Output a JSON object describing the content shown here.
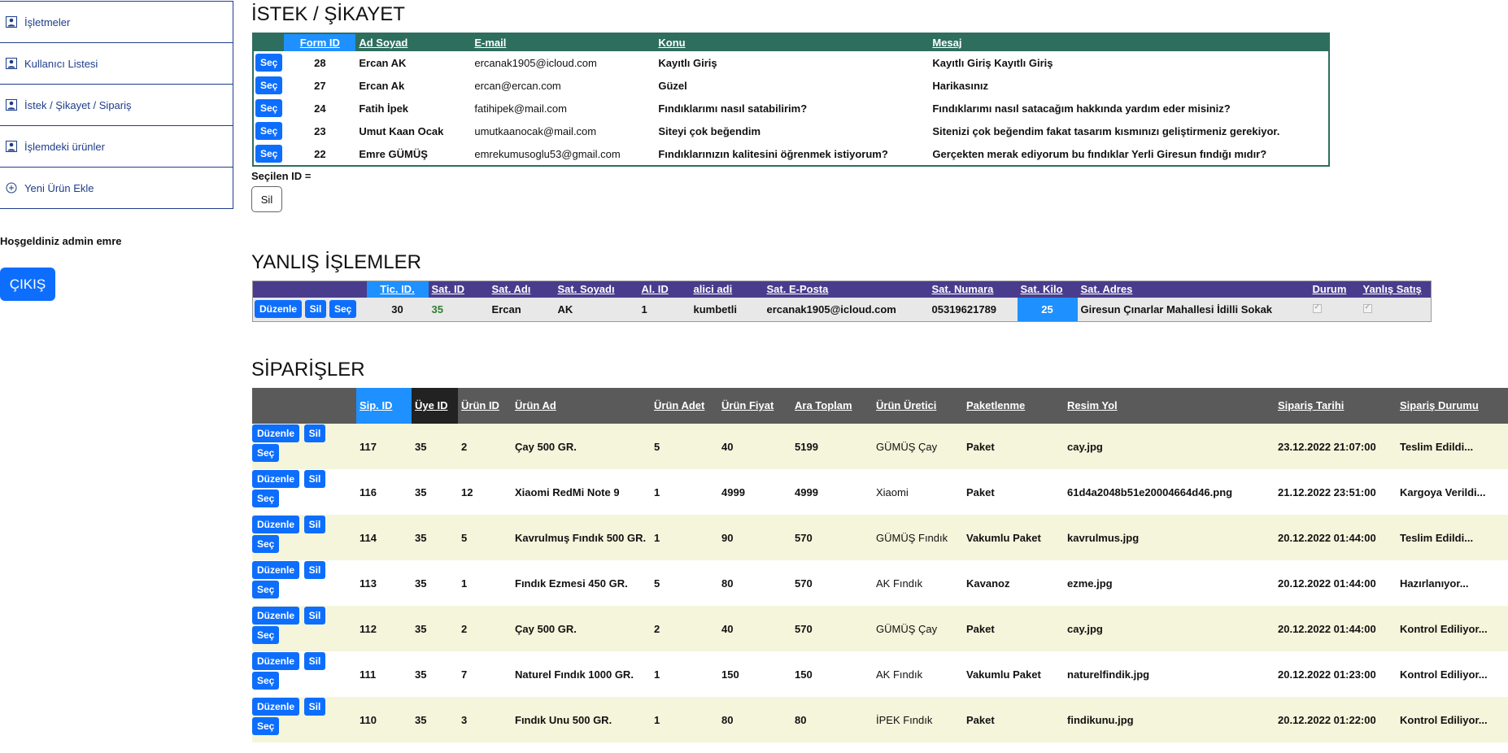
{
  "sidebar": {
    "items": [
      {
        "label": "İşletmeler",
        "icon": "user-icon"
      },
      {
        "label": "Kullanıcı Listesi",
        "icon": "user-icon"
      },
      {
        "label": "İstek / Şikayet / Sipariş",
        "icon": "user-icon"
      },
      {
        "label": "İşlemdeki ürünler",
        "icon": "user-icon"
      },
      {
        "label": "Yeni Ürün Ekle",
        "icon": "plus-circle-icon"
      }
    ],
    "welcome": "Hoşgeldiniz admin emre",
    "exit_label": "ÇIKIŞ"
  },
  "requests": {
    "title": "İSTEK / ŞİKAYET",
    "headers": [
      "Form ID",
      "Ad Soyad",
      "E-mail",
      "Konu",
      "Mesaj"
    ],
    "select_label": "Seç",
    "rows": [
      {
        "id": "28",
        "name": "Ercan AK",
        "email": "ercanak1905@icloud.com",
        "subject": "Kayıtlı Giriş",
        "message": "Kayıtlı Giriş Kayıtlı Giriş"
      },
      {
        "id": "27",
        "name": "Ercan Ak",
        "email": "ercan@ercan.com",
        "subject": "Güzel",
        "message": "Harikasınız"
      },
      {
        "id": "24",
        "name": "Fatih İpek",
        "email": "fatihipek@mail.com",
        "subject": "Fındıklarımı nasıl satabilirim?",
        "message": "Fındıklarımı nasıl satacağım hakkında yardım eder misiniz?"
      },
      {
        "id": "23",
        "name": "Umut Kaan Ocak",
        "email": "umutkaanocak@mail.com",
        "subject": "Siteyi çok beğendim",
        "message": "Sitenizi çok beğendim fakat tasarım kısmınızı geliştirmeniz gerekiyor."
      },
      {
        "id": "22",
        "name": "Emre GÜMÜŞ",
        "email": "emrekumusoglu53@gmail.com",
        "subject": "Fındıklarınızın kalitesini öğrenmek istiyorum?",
        "message": "Gerçekten merak ediyorum bu fındıklar Yerli Giresun fındığı mıdır?"
      }
    ],
    "selected_id_label": "Seçilen ID =",
    "delete_label": "Sil"
  },
  "wrong_ops": {
    "title": "YANLIŞ İŞLEMLER",
    "headers": [
      "Tic. ID.",
      "Sat. ID",
      "Sat. Adı",
      "Sat. Soyadı",
      "Al. ID",
      "alici adi",
      "Sat. E-Posta",
      "Sat. Numara",
      "Sat. Kilo",
      "Sat. Adres",
      "Durum",
      "Yanlış Satış"
    ],
    "actions": [
      "Düzenle",
      "Sil",
      "Seç"
    ],
    "row": {
      "tic_id": "30",
      "sat_id": "35",
      "sat_adi": "Ercan",
      "sat_soyadi": "AK",
      "al_id": "1",
      "alici_adi": "kumbetli",
      "email": "ercanak1905@icloud.com",
      "numara": "05319621789",
      "kilo": "25",
      "adres": "Giresun Çınarlar Mahallesi İdilli Sokak"
    }
  },
  "orders": {
    "title": "SİPARİŞLER",
    "headers": [
      "Sip. ID",
      "Üye ID",
      "Ürün ID",
      "Ürün Ad",
      "Ürün Adet",
      "Ürün Fiyat",
      "Ara Toplam",
      "Ürün Üretici",
      "Paketlenme",
      "Resim Yol",
      "Sipariş Tarihi",
      "Sipariş Durumu"
    ],
    "actions": [
      "Düzenle",
      "Sil",
      "Seç"
    ],
    "rows": [
      {
        "sip": "117",
        "uye": "35",
        "urun": "2",
        "ad": "Çay 500 GR.",
        "adet": "5",
        "fiyat": "40",
        "toplam": "5199",
        "uretici": "GÜMÜŞ Çay",
        "paket": "Paket",
        "resim": "cay.jpg",
        "tarih": "23.12.2022 21:07:00",
        "durum": "Teslim Edildi..."
      },
      {
        "sip": "116",
        "uye": "35",
        "urun": "12",
        "ad": "Xiaomi RedMi Note 9",
        "adet": "1",
        "fiyat": "4999",
        "toplam": "4999",
        "uretici": "Xiaomi",
        "paket": "Paket",
        "resim": "61d4a2048b51e20004664d46.png",
        "tarih": "21.12.2022 23:51:00",
        "durum": "Kargoya Verildi..."
      },
      {
        "sip": "114",
        "uye": "35",
        "urun": "5",
        "ad": "Kavrulmuş Fındık 500 GR.",
        "adet": "1",
        "fiyat": "90",
        "toplam": "570",
        "uretici": "GÜMÜŞ Fındık",
        "paket": "Vakumlu Paket",
        "resim": "kavrulmus.jpg",
        "tarih": "20.12.2022 01:44:00",
        "durum": "Teslim Edildi..."
      },
      {
        "sip": "113",
        "uye": "35",
        "urun": "1",
        "ad": "Fındık Ezmesi 450 GR.",
        "adet": "5",
        "fiyat": "80",
        "toplam": "570",
        "uretici": "AK Fındık",
        "paket": "Kavanoz",
        "resim": "ezme.jpg",
        "tarih": "20.12.2022 01:44:00",
        "durum": "Hazırlanıyor..."
      },
      {
        "sip": "112",
        "uye": "35",
        "urun": "2",
        "ad": "Çay 500 GR.",
        "adet": "2",
        "fiyat": "40",
        "toplam": "570",
        "uretici": "GÜMÜŞ Çay",
        "paket": "Paket",
        "resim": "cay.jpg",
        "tarih": "20.12.2022 01:44:00",
        "durum": "Kontrol Ediliyor..."
      },
      {
        "sip": "111",
        "uye": "35",
        "urun": "7",
        "ad": "Naturel Fındık 1000 GR.",
        "adet": "1",
        "fiyat": "150",
        "toplam": "150",
        "uretici": "AK Fındık",
        "paket": "Vakumlu Paket",
        "resim": "naturelfindik.jpg",
        "tarih": "20.12.2022 01:23:00",
        "durum": "Kontrol Ediliyor..."
      },
      {
        "sip": "110",
        "uye": "35",
        "urun": "3",
        "ad": "Fındık Unu 500 GR.",
        "adet": "1",
        "fiyat": "80",
        "toplam": "80",
        "uretici": "İPEK Fındık",
        "paket": "Paket",
        "resim": "findikunu.jpg",
        "tarih": "20.12.2022 01:22:00",
        "durum": "Kontrol Ediliyor..."
      }
    ]
  }
}
